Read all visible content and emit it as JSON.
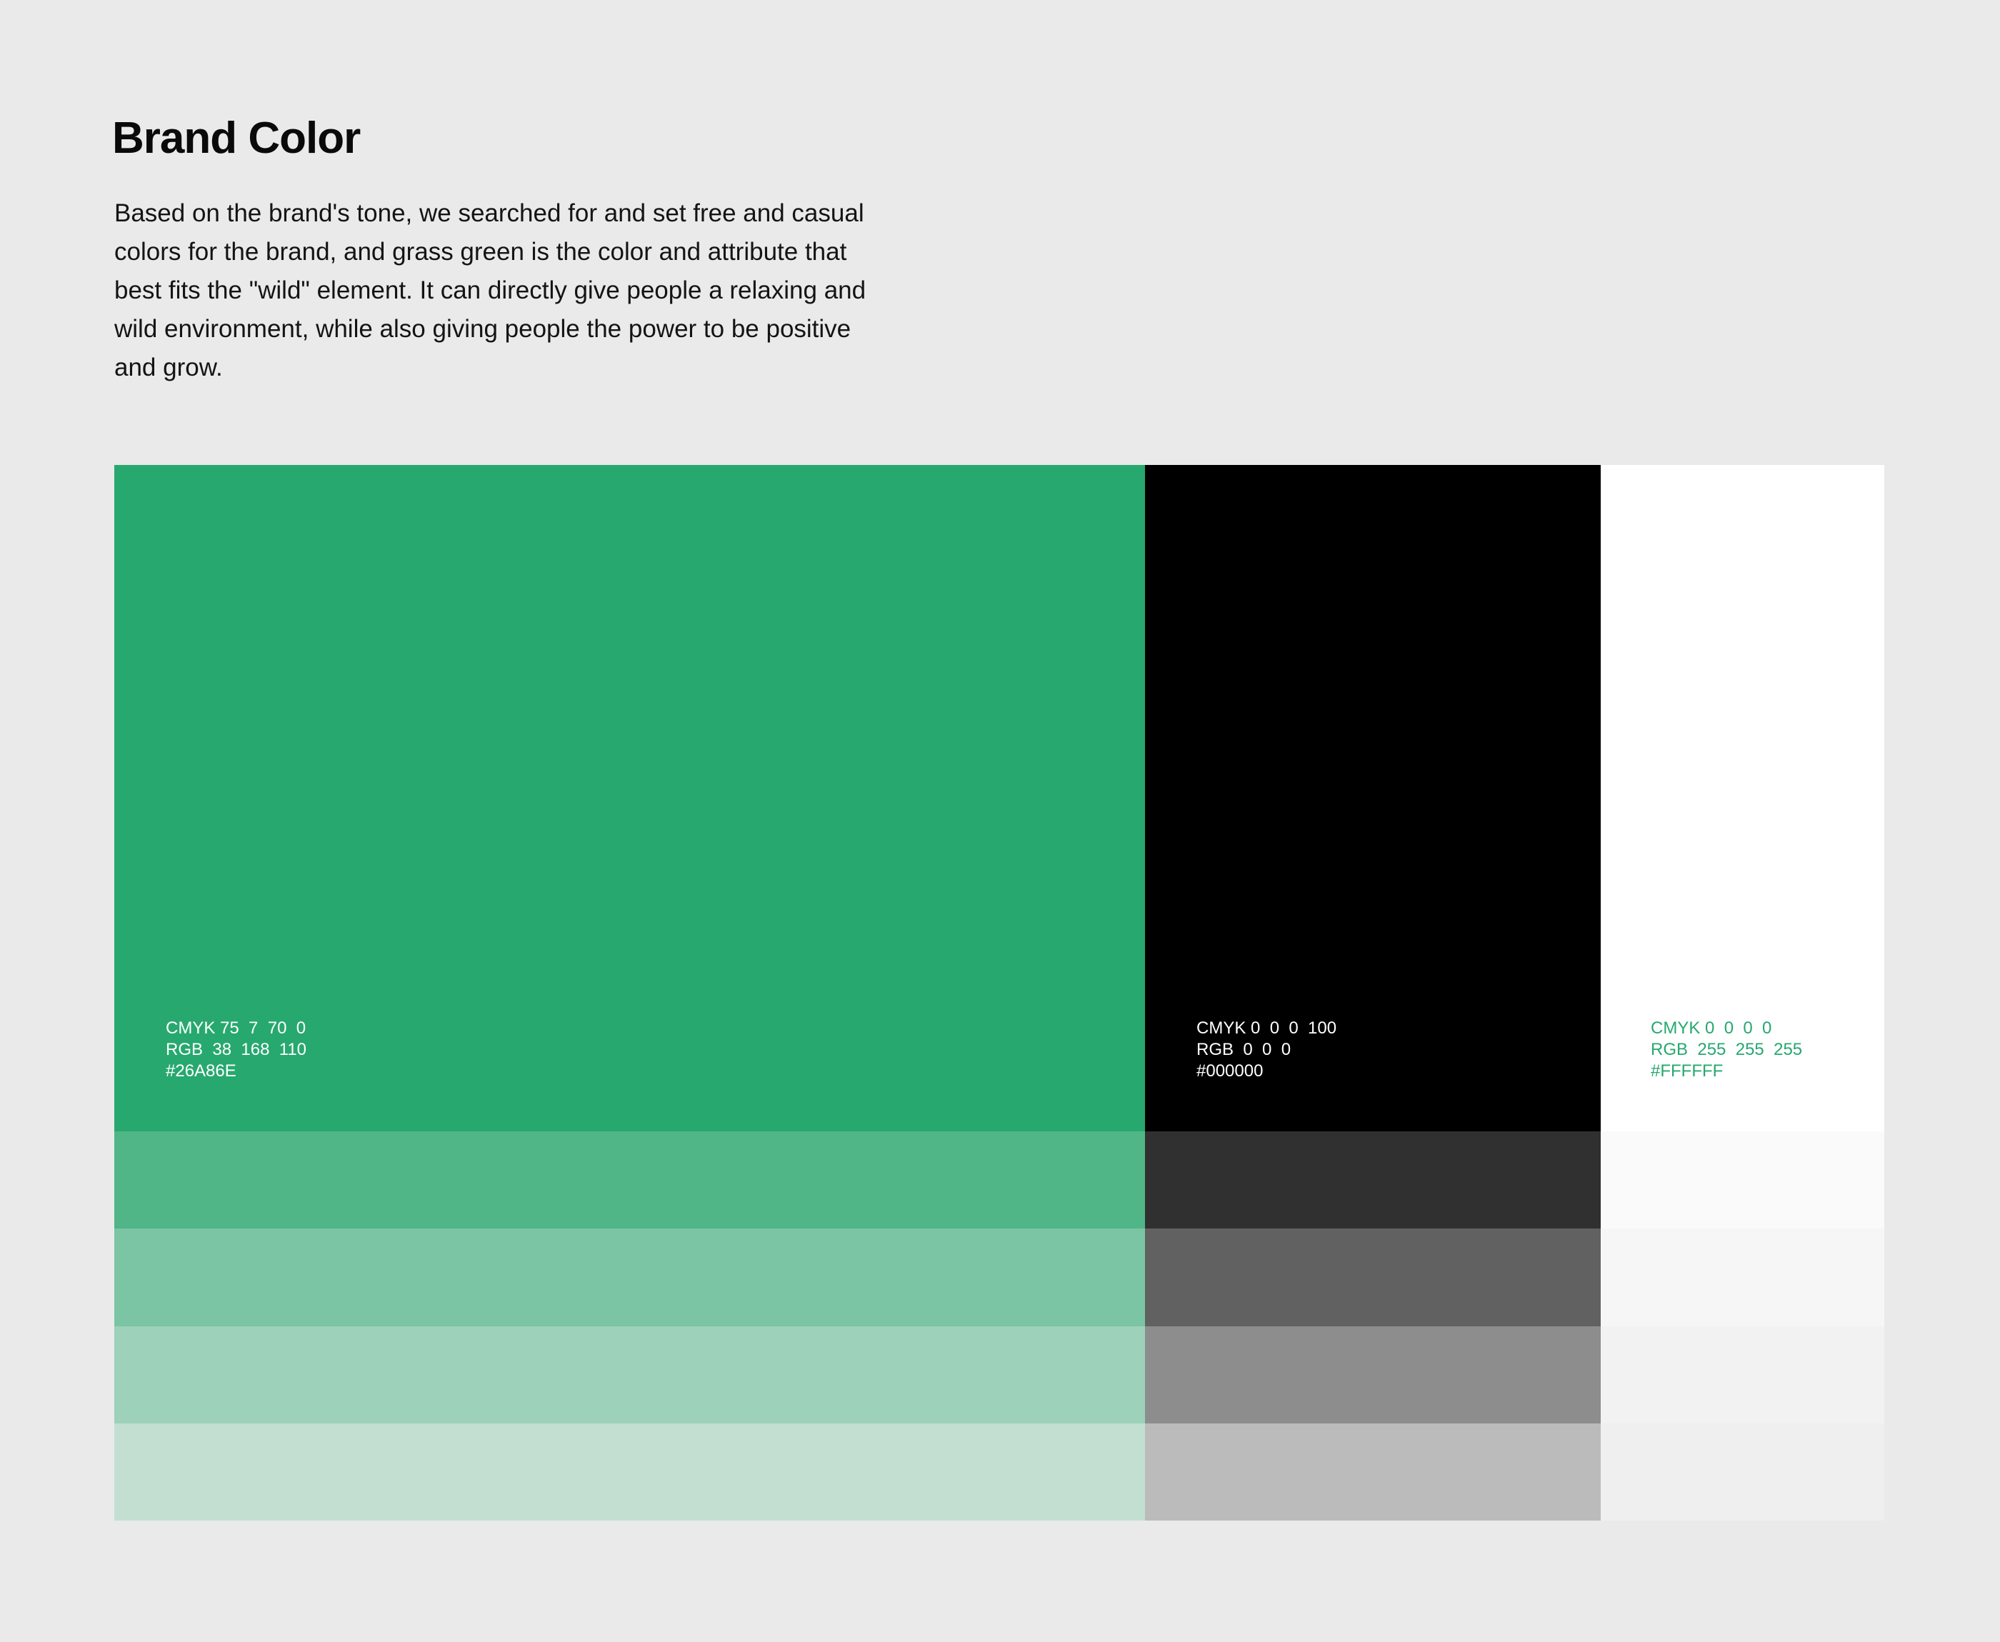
{
  "heading": {
    "title": "Brand Color",
    "description": "Based on the brand's tone, we searched for and set free and casual colors for the brand, and grass green is the color and attribute that best fits the \"wild\" element. It can directly give people a relaxing and wild environment, while also giving people the power to be positive and grow."
  },
  "colors": {
    "green": {
      "cmyk": "CMYK 75  7  70  0",
      "rgb": "RGB  38  168  110",
      "hex": "#26A86E",
      "swatch": "#27A86F",
      "text_color": "#FFFFFF",
      "tints": [
        "#50B587",
        "#7BC4A4",
        "#9ED1BA",
        "#C3DFD2"
      ]
    },
    "black": {
      "cmyk": "CMYK 0  0  0  100",
      "rgb": "RGB  0  0  0",
      "hex": "#000000",
      "swatch": "#000000",
      "text_color": "#FFFFFF",
      "tints": [
        "#303030",
        "#616161",
        "#8D8D8D",
        "#BBBBBB"
      ]
    },
    "white": {
      "cmyk": "CMYK 0  0  0  0",
      "rgb": "RGB  255  255  255",
      "hex": "#FFFFFF",
      "swatch": "#FFFFFF",
      "text_color": "#27A86F",
      "tints": [
        "#FAFAFA",
        "#F6F6F6",
        "#F2F2F2",
        "#EFEFEF"
      ]
    }
  }
}
